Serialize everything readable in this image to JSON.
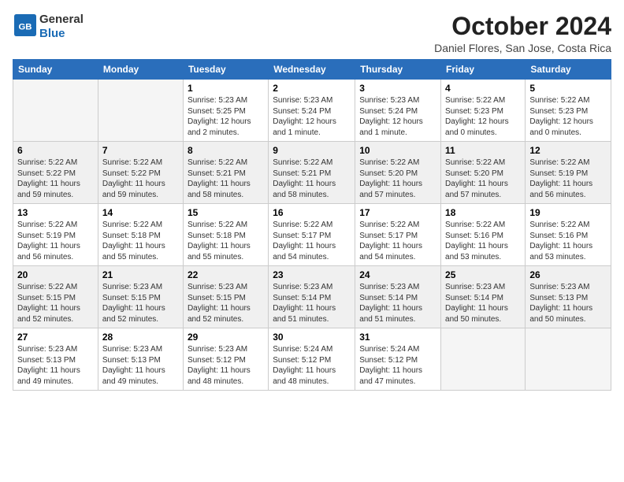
{
  "header": {
    "logo_general": "General",
    "logo_blue": "Blue",
    "month_title": "October 2024",
    "location": "Daniel Flores, San Jose, Costa Rica"
  },
  "days_of_week": [
    "Sunday",
    "Monday",
    "Tuesday",
    "Wednesday",
    "Thursday",
    "Friday",
    "Saturday"
  ],
  "weeks": [
    [
      {
        "date": "",
        "sunrise": "",
        "sunset": "",
        "daylight": "",
        "empty": true
      },
      {
        "date": "",
        "sunrise": "",
        "sunset": "",
        "daylight": "",
        "empty": true
      },
      {
        "date": "1",
        "sunrise": "Sunrise: 5:23 AM",
        "sunset": "Sunset: 5:25 PM",
        "daylight": "Daylight: 12 hours and 2 minutes."
      },
      {
        "date": "2",
        "sunrise": "Sunrise: 5:23 AM",
        "sunset": "Sunset: 5:24 PM",
        "daylight": "Daylight: 12 hours and 1 minute."
      },
      {
        "date": "3",
        "sunrise": "Sunrise: 5:23 AM",
        "sunset": "Sunset: 5:24 PM",
        "daylight": "Daylight: 12 hours and 1 minute."
      },
      {
        "date": "4",
        "sunrise": "Sunrise: 5:22 AM",
        "sunset": "Sunset: 5:23 PM",
        "daylight": "Daylight: 12 hours and 0 minutes."
      },
      {
        "date": "5",
        "sunrise": "Sunrise: 5:22 AM",
        "sunset": "Sunset: 5:23 PM",
        "daylight": "Daylight: 12 hours and 0 minutes."
      }
    ],
    [
      {
        "date": "6",
        "sunrise": "Sunrise: 5:22 AM",
        "sunset": "Sunset: 5:22 PM",
        "daylight": "Daylight: 11 hours and 59 minutes."
      },
      {
        "date": "7",
        "sunrise": "Sunrise: 5:22 AM",
        "sunset": "Sunset: 5:22 PM",
        "daylight": "Daylight: 11 hours and 59 minutes."
      },
      {
        "date": "8",
        "sunrise": "Sunrise: 5:22 AM",
        "sunset": "Sunset: 5:21 PM",
        "daylight": "Daylight: 11 hours and 58 minutes."
      },
      {
        "date": "9",
        "sunrise": "Sunrise: 5:22 AM",
        "sunset": "Sunset: 5:21 PM",
        "daylight": "Daylight: 11 hours and 58 minutes."
      },
      {
        "date": "10",
        "sunrise": "Sunrise: 5:22 AM",
        "sunset": "Sunset: 5:20 PM",
        "daylight": "Daylight: 11 hours and 57 minutes."
      },
      {
        "date": "11",
        "sunrise": "Sunrise: 5:22 AM",
        "sunset": "Sunset: 5:20 PM",
        "daylight": "Daylight: 11 hours and 57 minutes."
      },
      {
        "date": "12",
        "sunrise": "Sunrise: 5:22 AM",
        "sunset": "Sunset: 5:19 PM",
        "daylight": "Daylight: 11 hours and 56 minutes."
      }
    ],
    [
      {
        "date": "13",
        "sunrise": "Sunrise: 5:22 AM",
        "sunset": "Sunset: 5:19 PM",
        "daylight": "Daylight: 11 hours and 56 minutes."
      },
      {
        "date": "14",
        "sunrise": "Sunrise: 5:22 AM",
        "sunset": "Sunset: 5:18 PM",
        "daylight": "Daylight: 11 hours and 55 minutes."
      },
      {
        "date": "15",
        "sunrise": "Sunrise: 5:22 AM",
        "sunset": "Sunset: 5:18 PM",
        "daylight": "Daylight: 11 hours and 55 minutes."
      },
      {
        "date": "16",
        "sunrise": "Sunrise: 5:22 AM",
        "sunset": "Sunset: 5:17 PM",
        "daylight": "Daylight: 11 hours and 54 minutes."
      },
      {
        "date": "17",
        "sunrise": "Sunrise: 5:22 AM",
        "sunset": "Sunset: 5:17 PM",
        "daylight": "Daylight: 11 hours and 54 minutes."
      },
      {
        "date": "18",
        "sunrise": "Sunrise: 5:22 AM",
        "sunset": "Sunset: 5:16 PM",
        "daylight": "Daylight: 11 hours and 53 minutes."
      },
      {
        "date": "19",
        "sunrise": "Sunrise: 5:22 AM",
        "sunset": "Sunset: 5:16 PM",
        "daylight": "Daylight: 11 hours and 53 minutes."
      }
    ],
    [
      {
        "date": "20",
        "sunrise": "Sunrise: 5:22 AM",
        "sunset": "Sunset: 5:15 PM",
        "daylight": "Daylight: 11 hours and 52 minutes."
      },
      {
        "date": "21",
        "sunrise": "Sunrise: 5:23 AM",
        "sunset": "Sunset: 5:15 PM",
        "daylight": "Daylight: 11 hours and 52 minutes."
      },
      {
        "date": "22",
        "sunrise": "Sunrise: 5:23 AM",
        "sunset": "Sunset: 5:15 PM",
        "daylight": "Daylight: 11 hours and 52 minutes."
      },
      {
        "date": "23",
        "sunrise": "Sunrise: 5:23 AM",
        "sunset": "Sunset: 5:14 PM",
        "daylight": "Daylight: 11 hours and 51 minutes."
      },
      {
        "date": "24",
        "sunrise": "Sunrise: 5:23 AM",
        "sunset": "Sunset: 5:14 PM",
        "daylight": "Daylight: 11 hours and 51 minutes."
      },
      {
        "date": "25",
        "sunrise": "Sunrise: 5:23 AM",
        "sunset": "Sunset: 5:14 PM",
        "daylight": "Daylight: 11 hours and 50 minutes."
      },
      {
        "date": "26",
        "sunrise": "Sunrise: 5:23 AM",
        "sunset": "Sunset: 5:13 PM",
        "daylight": "Daylight: 11 hours and 50 minutes."
      }
    ],
    [
      {
        "date": "27",
        "sunrise": "Sunrise: 5:23 AM",
        "sunset": "Sunset: 5:13 PM",
        "daylight": "Daylight: 11 hours and 49 minutes."
      },
      {
        "date": "28",
        "sunrise": "Sunrise: 5:23 AM",
        "sunset": "Sunset: 5:13 PM",
        "daylight": "Daylight: 11 hours and 49 minutes."
      },
      {
        "date": "29",
        "sunrise": "Sunrise: 5:23 AM",
        "sunset": "Sunset: 5:12 PM",
        "daylight": "Daylight: 11 hours and 48 minutes."
      },
      {
        "date": "30",
        "sunrise": "Sunrise: 5:24 AM",
        "sunset": "Sunset: 5:12 PM",
        "daylight": "Daylight: 11 hours and 48 minutes."
      },
      {
        "date": "31",
        "sunrise": "Sunrise: 5:24 AM",
        "sunset": "Sunset: 5:12 PM",
        "daylight": "Daylight: 11 hours and 47 minutes."
      },
      {
        "date": "",
        "sunrise": "",
        "sunset": "",
        "daylight": "",
        "empty": true
      },
      {
        "date": "",
        "sunrise": "",
        "sunset": "",
        "daylight": "",
        "empty": true
      }
    ]
  ]
}
